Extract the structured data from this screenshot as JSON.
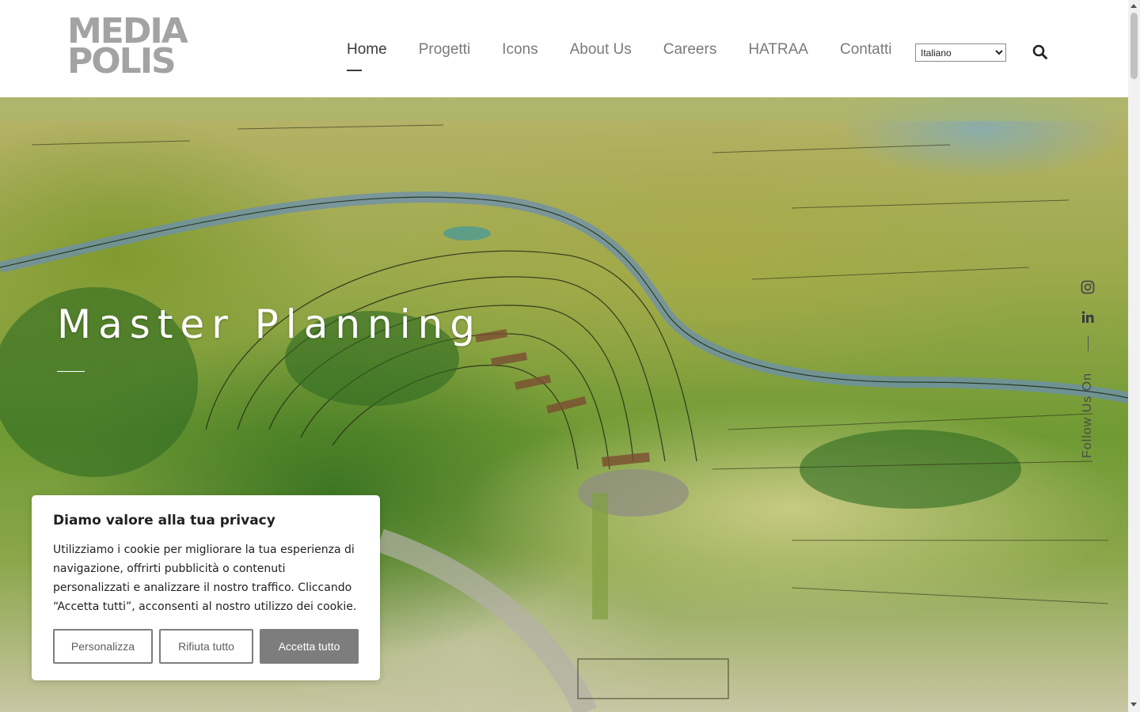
{
  "header": {
    "logo_line1": "MEDIA",
    "logo_line2": "POLIS",
    "nav": [
      {
        "label": "Home",
        "active": true
      },
      {
        "label": "Progetti"
      },
      {
        "label": "Icons"
      },
      {
        "label": "About Us"
      },
      {
        "label": "Careers"
      },
      {
        "label": "HATRAA"
      },
      {
        "label": "Contatti"
      }
    ],
    "language": {
      "selected": "Italiano"
    },
    "search_icon": "search-icon"
  },
  "hero": {
    "title": "Master Planning",
    "follow_label": "Follow Us On",
    "social_icons": [
      "instagram-icon",
      "linkedin-icon"
    ]
  },
  "cookie_banner": {
    "title": "Diamo valore alla tua privacy",
    "text": "Utilizziamo i cookie per migliorare la tua esperienza di navigazione, offrirti pubblicità o contenuti personalizzati e analizzare il nostro traffico. Cliccando “Accetta tutti”, acconsenti al nostro utilizzo dei cookie.",
    "customize_label": "Personalizza",
    "reject_label": "Rifiuta tutto",
    "accept_label": "Accetta tutto"
  },
  "colors": {
    "accent_button": "#7d7d7d",
    "nav_active": "#3b3b3b",
    "nav_inactive": "#7a7a7a",
    "logo": "#a3a3a3"
  }
}
